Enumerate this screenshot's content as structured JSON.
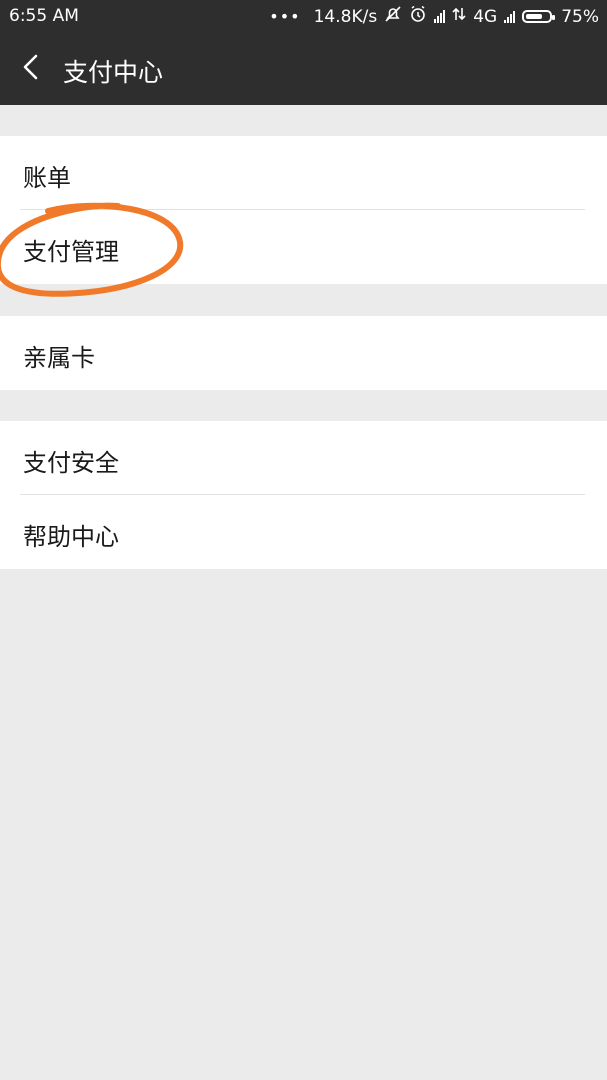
{
  "status_bar": {
    "time": "6:55  AM",
    "dots": "•••",
    "net_speed": "14.8K/s",
    "network": "4G",
    "battery": "75%"
  },
  "header": {
    "title": "支付中心"
  },
  "groups": [
    {
      "items": [
        {
          "label": "账单"
        },
        {
          "label": "支付管理"
        }
      ]
    },
    {
      "items": [
        {
          "label": "亲属卡"
        }
      ]
    },
    {
      "items": [
        {
          "label": "支付安全"
        },
        {
          "label": "帮助中心"
        }
      ]
    }
  ],
  "annotation_color": "#f07a2a"
}
